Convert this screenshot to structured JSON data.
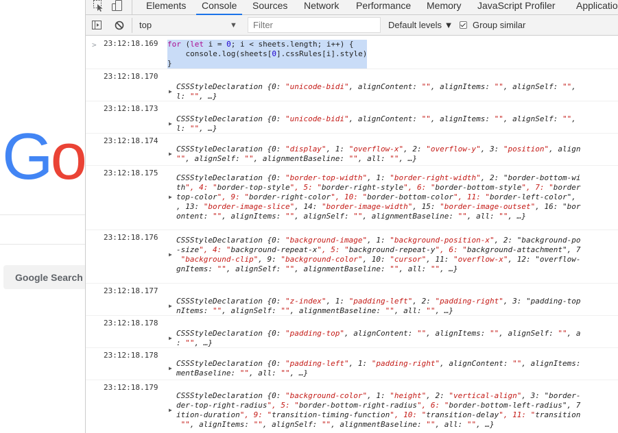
{
  "page": {
    "logo_text_g": "G",
    "logo_text_o": "o",
    "search_button": "Google Search"
  },
  "devtools": {
    "tabs": [
      "Elements",
      "Console",
      "Sources",
      "Network",
      "Performance",
      "Memory",
      "JavaScript Profiler",
      "Application"
    ],
    "active_tab": "Console",
    "context_selector": "top",
    "filter_placeholder": "Filter",
    "log_levels": "Default levels ▼",
    "group_similar": "Group similar",
    "group_similar_checked": true
  },
  "console": {
    "command": {
      "timestamp": "23:12:18.169",
      "lines": [
        "for (let i = 0; i < sheets.length; i++) {",
        "    console.log(sheets[0].cssRules[i].style)",
        "}"
      ]
    },
    "messages": [
      {
        "timestamp": "23:12:18.170",
        "lines": [
          "CSSStyleDeclaration {0: \"unicode-bidi\", alignContent: \"\", alignItems: \"\", alignSelf: \"\",",
          "l: \"\", …}"
        ]
      },
      {
        "timestamp": "23:12:18.173",
        "lines": [
          "CSSStyleDeclaration {0: \"unicode-bidi\", alignContent: \"\", alignItems: \"\", alignSelf: \"\",",
          "l: \"\", …}"
        ]
      },
      {
        "timestamp": "23:12:18.174",
        "lines": [
          "CSSStyleDeclaration {0: \"display\", 1: \"overflow-x\", 2: \"overflow-y\", 3: \"position\", align",
          "\"\", alignSelf: \"\", alignmentBaseline: \"\", all: \"\", …}"
        ]
      },
      {
        "timestamp": "23:12:18.175",
        "lines": [
          "CSSStyleDeclaration {0: \"border-top-width\", 1: \"border-right-width\", 2: \"border-bottom-wi",
          "th\", 4: \"border-top-style\", 5: \"border-right-style\", 6: \"border-bottom-style\", 7: \"border",
          "top-color\", 9: \"border-right-color\", 10: \"border-bottom-color\", 11: \"border-left-color\", ",
          ", 13: \"border-image-slice\", 14: \"border-image-width\", 15: \"border-image-outset\", 16: \"bor",
          "ontent: \"\", alignItems: \"\", alignSelf: \"\", alignmentBaseline: \"\", all: \"\", …}"
        ]
      },
      {
        "timestamp": "23:12:18.176",
        "lines": [
          "CSSStyleDeclaration {0: \"background-image\", 1: \"background-position-x\", 2: \"background-po",
          "-size\", 4: \"background-repeat-x\", 5: \"background-repeat-y\", 6: \"background-attachment\", 7",
          " \"background-clip\", 9: \"background-color\", 10: \"cursor\", 11: \"overflow-x\", 12: \"overflow-",
          "gnItems: \"\", alignSelf: \"\", alignmentBaseline: \"\", all: \"\", …}"
        ]
      },
      {
        "timestamp": "23:12:18.177",
        "lines": [
          "CSSStyleDeclaration {0: \"z-index\", 1: \"padding-left\", 2: \"padding-right\", 3: \"padding-top",
          "nItems: \"\", alignSelf: \"\", alignmentBaseline: \"\", all: \"\", …}"
        ]
      },
      {
        "timestamp": "23:12:18.178",
        "lines": [
          "CSSStyleDeclaration {0: \"padding-top\", alignContent: \"\", alignItems: \"\", alignSelf: \"\", a",
          ": \"\", …}"
        ]
      },
      {
        "timestamp": "23:12:18.178",
        "lines": [
          "CSSStyleDeclaration {0: \"padding-left\", 1: \"padding-right\", alignContent: \"\", alignItems:",
          "mentBaseline: \"\", all: \"\", …}"
        ]
      },
      {
        "timestamp": "23:12:18.179",
        "lines": [
          "CSSStyleDeclaration {0: \"background-color\", 1: \"height\", 2: \"vertical-align\", 3: \"border-",
          "der-top-right-radius\", 5: \"border-bottom-right-radius\", 6: \"border-bottom-left-radius\", 7",
          "ition-duration\", 9: \"transition-timing-function\", 10: \"transition-delay\", 11: \"transition",
          " \"\", alignItems: \"\", alignSelf: \"\", alignmentBaseline: \"\", all: \"\", …}"
        ]
      }
    ]
  }
}
